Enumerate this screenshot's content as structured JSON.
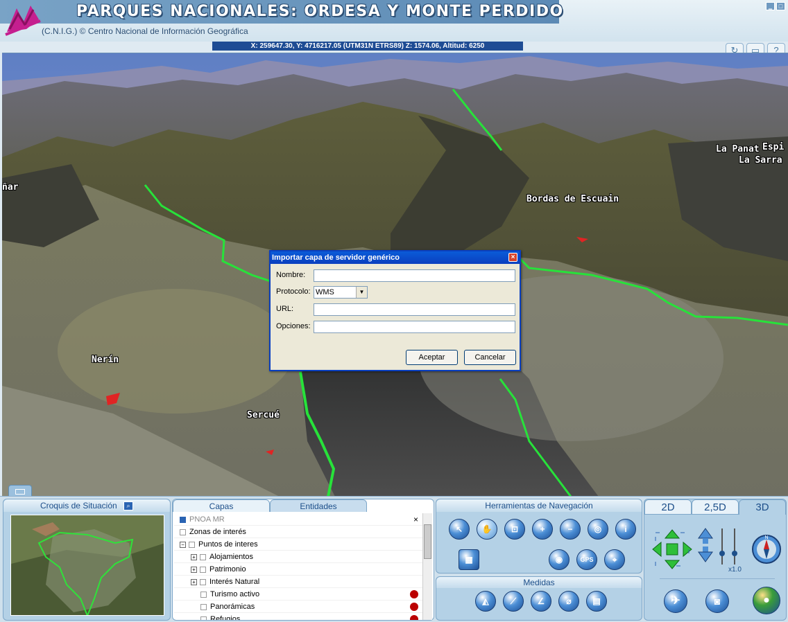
{
  "header": {
    "title": "PARQUES NACIONALES: ORDESA Y MONTE PERDIDO",
    "subtitle": "(C.N.I.G.)  © Centro Nacional de Información Geográfica",
    "window_buttons": [
      "minimize-icon",
      "maximize-icon"
    ]
  },
  "coords": "X: 259647.30, Y: 4716217.05 (UTM31N ETRS89)  Z: 1574.06, Altitud: 6250",
  "toolbar": {
    "refresh_icon": "refresh-icon",
    "print_icon": "print-icon",
    "help_label": "?"
  },
  "places": {
    "la_panat": "La Panat",
    "espi": "Espi",
    "la_sarra": "La Sarra",
    "nar": "ñar",
    "bordas": "Bordas de Escuain",
    "nerin": "Nerín",
    "sercue": "Sercué"
  },
  "dialog": {
    "title": "Importar capa de servidor genérico",
    "close_label": "×",
    "nombre_label": "Nombre:",
    "protocolo_label": "Protocolo:",
    "protocolo_value": "WMS",
    "url_label": "URL:",
    "opciones_label": "Opciones:",
    "accept_label": "Aceptar",
    "cancel_label": "Cancelar"
  },
  "croquis": {
    "title": "Croquis de Situación"
  },
  "capas": {
    "tab_capas": "Capas",
    "tab_entidades": "Entidades",
    "layers": [
      {
        "label": "PNOA MR",
        "checked": true,
        "expand": false,
        "indent": 0,
        "close": "×"
      },
      {
        "label": "Zonas de interés",
        "checked": false,
        "expand": false,
        "indent": 0
      },
      {
        "label": "Puntos de interes",
        "checked": false,
        "expand": true,
        "indent": 0,
        "expand_sign": "−"
      },
      {
        "label": "Alojamientos",
        "checked": false,
        "expand": true,
        "indent": 1,
        "expand_sign": "+"
      },
      {
        "label": "Patrimonio",
        "checked": false,
        "expand": true,
        "indent": 1,
        "expand_sign": "+"
      },
      {
        "label": "Interés Natural",
        "checked": false,
        "expand": true,
        "indent": 1,
        "expand_sign": "+"
      },
      {
        "label": "Turismo activo",
        "checked": false,
        "expand": false,
        "indent": 1,
        "symbol": true
      },
      {
        "label": "Panorámicas",
        "checked": false,
        "expand": false,
        "indent": 1,
        "symbol": true
      },
      {
        "label": "Refugios",
        "checked": false,
        "expand": false,
        "indent": 1,
        "symbol": true
      }
    ]
  },
  "herramientas": {
    "title": "Herramientas de Navegación",
    "tools": [
      {
        "name": "pointer-icon",
        "label": "↖"
      },
      {
        "name": "pan-hand-icon",
        "label": "✋"
      },
      {
        "name": "zoom-window-icon",
        "label": "⊡"
      },
      {
        "name": "zoom-in-icon",
        "label": "+"
      },
      {
        "name": "zoom-out-icon",
        "label": "−"
      },
      {
        "name": "globe-icon",
        "label": "◎"
      },
      {
        "name": "info-icon",
        "label": "i"
      },
      {
        "name": "overview-icon",
        "label": "▦"
      },
      {
        "name": "cd-icon",
        "label": "◉"
      },
      {
        "name": "gps-icon",
        "label": "GPS"
      },
      {
        "name": "locate-icon",
        "label": "⌖"
      }
    ]
  },
  "medidas": {
    "title": "Medidas",
    "tools": [
      {
        "name": "measure-area-icon",
        "label": "◭"
      },
      {
        "name": "measure-distance-icon",
        "label": "⟋"
      },
      {
        "name": "measure-angle-icon",
        "label": "∠"
      },
      {
        "name": "profile-icon",
        "label": "⌀"
      },
      {
        "name": "calculator-icon",
        "label": "▤"
      }
    ]
  },
  "view": {
    "tab_2d": "2D",
    "tab_25d": "2,5D",
    "tab_3d": "3D",
    "zoom_factor": "x1.0",
    "compass_label": "N"
  },
  "colors": {
    "accent": "#1e4c94",
    "route": "#27e23a",
    "dialog_title": "#0a3fbf"
  }
}
